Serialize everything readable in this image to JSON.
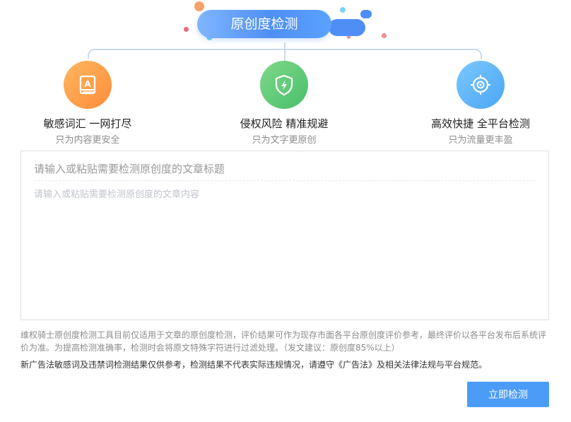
{
  "header": {
    "title": "原创度检测"
  },
  "features": [
    {
      "title": "敏感词汇 一网打尽",
      "subtitle": "只为内容更安全",
      "icon": "book-icon"
    },
    {
      "title": "侵权风险 精准规避",
      "subtitle": "只为文字更原创",
      "icon": "shield-bolt-icon"
    },
    {
      "title": "高效快捷 全平台检测",
      "subtitle": "只为流量更丰盈",
      "icon": "target-icon"
    }
  ],
  "form": {
    "title_placeholder": "请输入或粘贴需要检测原创度的文章标题",
    "content_placeholder": "请输入或粘贴需要检测原创度的文章内容"
  },
  "notice": {
    "line1": "维权骑士原创度检测工具目前仅适用于文章的原创度检测，评价结果可作为现存市面各平台原创度评价参考，最终评价以各平台发布后系统评价为准。为提高检测准确率，检测时会将原文特殊字符进行过滤处理。（发文建议：原创度85%以上）",
    "line2": "新广告法敏感词及违禁词检测结果仅供参考，检测结果不代表实际违规情况，请遵守《广告法》及相关法律法规与平台规范。"
  },
  "actions": {
    "submit_label": "立即检测"
  },
  "colors": {
    "accent": "#4b9cf7",
    "orange": "#ff9a45",
    "green": "#5cc777",
    "blue": "#5ab3fb"
  }
}
